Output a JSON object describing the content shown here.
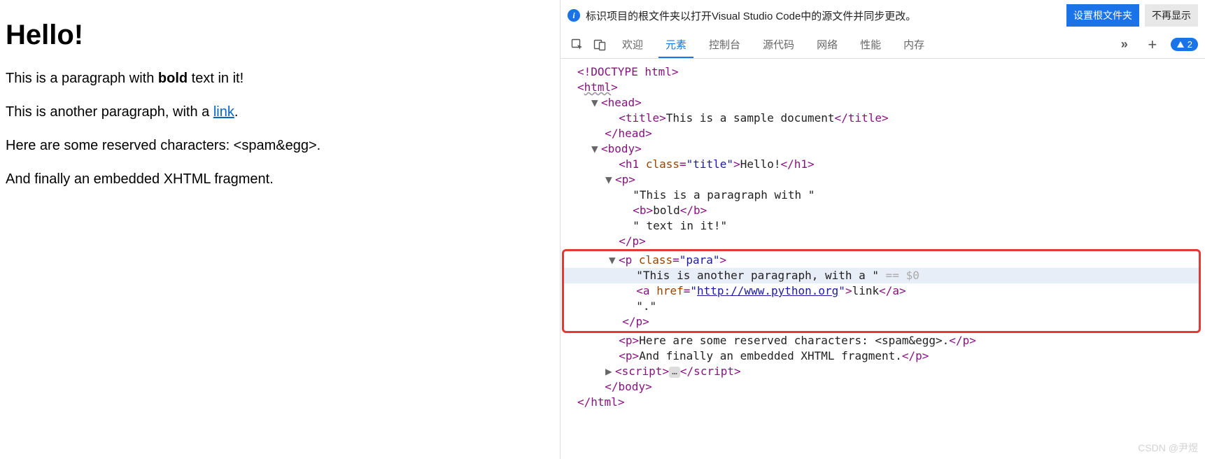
{
  "page": {
    "title": "Hello!",
    "p1_before": "This is a paragraph with ",
    "p1_bold": "bold",
    "p1_after": " text in it!",
    "p2_before": "This is another paragraph, with a ",
    "p2_link": "link",
    "p2_after": ".",
    "p3": "Here are some reserved characters: <spam&egg>.",
    "p4": "And finally an embedded XHTML fragment."
  },
  "infobar": {
    "text": "标识项目的根文件夹以打开Visual Studio Code中的源文件并同步更改。",
    "btn_primary": "设置根文件夹",
    "btn_secondary": "不再显示"
  },
  "tabs": {
    "t0": "欢迎",
    "t1": "元素",
    "t2": "控制台",
    "t3": "源代码",
    "t4": "网络",
    "t5": "性能",
    "t6": "内存",
    "more": "»",
    "plus": "+",
    "badge": "2"
  },
  "dom": {
    "doctype": "<!DOCTYPE html>",
    "html_open": "html",
    "head_open": "head",
    "title_open": "title",
    "title_text": "This is a sample document",
    "title_close": "/title",
    "head_close": "/head",
    "body_open": "body",
    "h1_open": "h1",
    "h1_class_attr": "class",
    "h1_class_val": "\"title\"",
    "h1_text": "Hello!",
    "h1_close": "/h1",
    "p_open": "p",
    "p_close": "/p",
    "p1_text_a": "\"This is a paragraph with \"",
    "b_open": "b",
    "b_text": "bold",
    "b_close": "/b",
    "p1_text_c": "\" text in it!\"",
    "p2_class_attr": "class",
    "p2_class_val": "\"para\"",
    "p2_text_a": "\"This is another paragraph, with a \"",
    "p2_hint": " == $0",
    "a_open": "a",
    "a_href_attr": "href",
    "a_href_val_q": "\"",
    "a_href_val": "http://www.python.org",
    "a_text": "link",
    "a_close": "/a",
    "p2_text_c": "\".\"",
    "p3_text": "Here are some reserved characters: <spam&egg>.",
    "p4_text": "And finally an embedded XHTML fragment.",
    "script_open": "script",
    "script_close": "/script",
    "ellipsis": "…",
    "body_close": "/body",
    "html_close": "/html",
    "arrow_down": "▼",
    "arrow_right": "▶"
  },
  "watermark": "CSDN @尹煜"
}
